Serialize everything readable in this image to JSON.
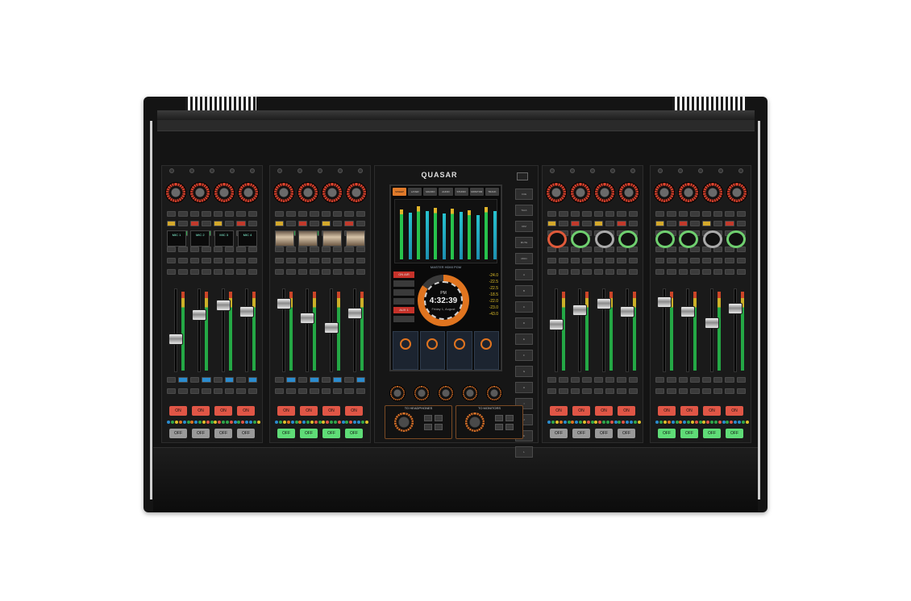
{
  "brand": {
    "name": "QUASAR"
  },
  "screen": {
    "tabs": [
      "SWEEP MODE",
      "LAYER MIXES",
      "MACRO VOICE",
      "AUDIO FOLLOW",
      "STUDIO OUTS",
      "MONITOR FX",
      "TRACK TOOLS"
    ],
    "master_label": "MASTER HDMI PGM",
    "clock": {
      "ampm": "PM",
      "time": "4:32:39",
      "date": "Friday 1, August"
    },
    "side_items": [
      "ON AIR",
      "",
      "",
      "",
      "AUX 1",
      "",
      ""
    ],
    "readouts": [
      "-24.0",
      "-22.5",
      "-22.5",
      "-18.5",
      "-22.0",
      "-23.0",
      "-43.0"
    ],
    "lower_panels": [
      "HEADPHONE",
      "PREVIEW",
      "TALK TO ENGR",
      "STUDIO MONITOR"
    ]
  },
  "channel_labels": [
    "MIC 1",
    "MIC 2",
    "MIC 3",
    "MIC 4"
  ],
  "buttons": {
    "on": "ON",
    "off": "OFF"
  },
  "right_buttons": [
    "CUE",
    "TALK",
    "DIM",
    "MUTE",
    "MON",
    "A",
    "B",
    "C",
    "D",
    "E",
    "F",
    "G",
    "H",
    "I",
    "J",
    "K",
    "L"
  ],
  "control_blocks": [
    "TO HEADPHONES",
    "TO MONITORS"
  ],
  "colors": {
    "accent": "#e07a2a",
    "on_red": "#e05646",
    "off_green": "#5fdc77",
    "meter_green": "#25b84a"
  }
}
